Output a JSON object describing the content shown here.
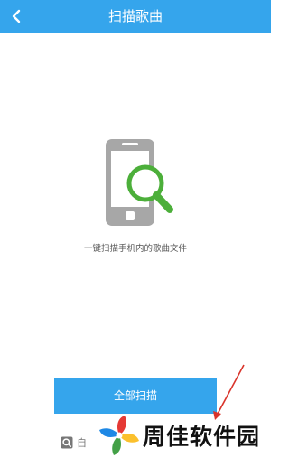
{
  "header": {
    "title": "扫描歌曲",
    "back_icon": "chevron-left-icon"
  },
  "main": {
    "illustration_icon": "phone-magnifier-icon",
    "hint": "一键扫描手机内的歌曲文件",
    "scan_all_label": "全部扫描",
    "custom_scan_label": "自",
    "custom_scan_icon": "search-square-icon"
  },
  "overlay": {
    "watermark_text": "周佳软件园",
    "arrow_color": "#d9342b"
  },
  "colors": {
    "accent": "#35a5ec",
    "magnifier": "#4caf3a",
    "phone": "#a7a7a7"
  }
}
